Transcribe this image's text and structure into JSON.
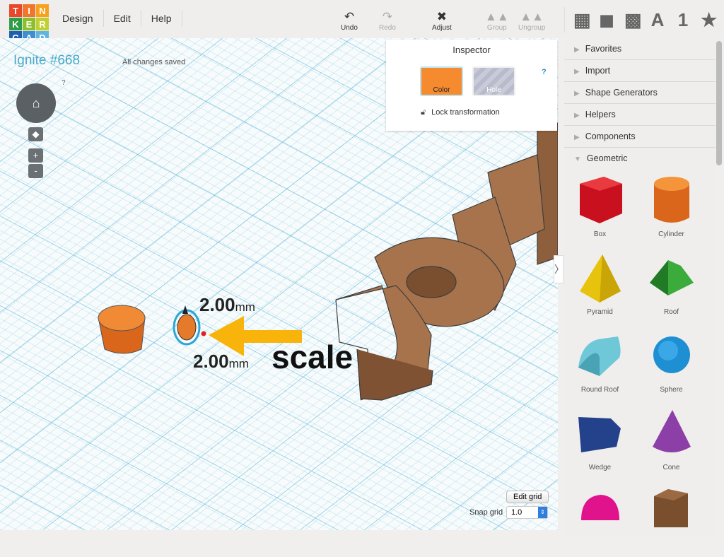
{
  "logo": [
    "T",
    "I",
    "N",
    "K",
    "E",
    "R",
    "C",
    "A",
    "D"
  ],
  "logo_colors": [
    "#e8472c",
    "#f0762c",
    "#f7a21c",
    "#2f9d47",
    "#8bbf2b",
    "#c2cf30",
    "#1f5fae",
    "#3d8fcf",
    "#60b5e0"
  ],
  "menu": [
    "Design",
    "Edit",
    "Help"
  ],
  "toolbar": {
    "undo": "Undo",
    "redo": "Redo",
    "adjust": "Adjust",
    "group": "Group",
    "ungroup": "Ungroup"
  },
  "view_tools": [
    "grid-view-icon",
    "box-icon",
    "striped-box-icon",
    "A",
    "1",
    "★"
  ],
  "project": {
    "title": "Ignite #668",
    "status": "All changes saved"
  },
  "nav_help": "?",
  "zoom": {
    "in": "+",
    "out": "-"
  },
  "inspector": {
    "title": "Inspector",
    "color": "Color",
    "hole": "Hole",
    "help": "?",
    "lock": "Lock transformation",
    "color_hex": "#f58a2f"
  },
  "categories": [
    {
      "label": "Favorites"
    },
    {
      "label": "Import"
    },
    {
      "label": "Shape Generators"
    },
    {
      "label": "Helpers"
    },
    {
      "label": "Components"
    },
    {
      "label": "Geometric",
      "open": true
    }
  ],
  "shapes": [
    {
      "label": "Box"
    },
    {
      "label": "Cylinder"
    },
    {
      "label": "Pyramid"
    },
    {
      "label": "Roof"
    },
    {
      "label": "Round Roof"
    },
    {
      "label": "Sphere"
    },
    {
      "label": "Wedge"
    },
    {
      "label": "Cone"
    }
  ],
  "dimensions": {
    "top": "2.00",
    "bottom": "2.00",
    "unit": "mm"
  },
  "annotation": "scale",
  "grid": {
    "edit": "Edit grid",
    "snap_label": "Snap grid",
    "snap_value": "1.0"
  }
}
